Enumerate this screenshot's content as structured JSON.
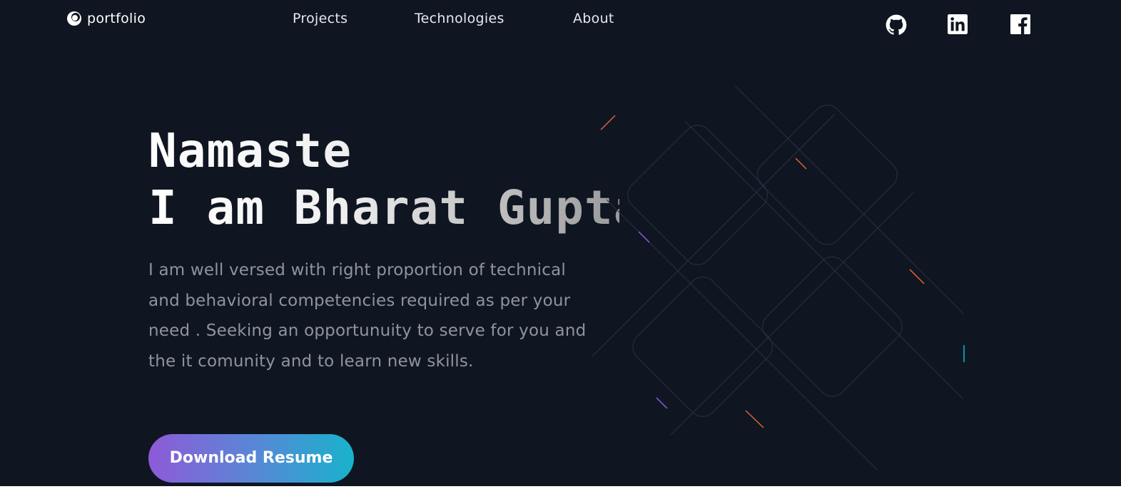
{
  "nav": {
    "logo_text": "portfolio",
    "links": [
      {
        "label": "Projects"
      },
      {
        "label": "Technologies"
      },
      {
        "label": "About"
      }
    ],
    "social_icons": [
      "github-icon",
      "linkedin-icon",
      "facebook-icon"
    ]
  },
  "hero": {
    "title_line1": "Namaste",
    "title_line2": "I am Bharat Gupta",
    "description": "I am well versed with right proportion of technical and behavioral competencies required as per your need . Seeking an opportunuity to serve for you and the it comunity and to learn new skills.",
    "button_label": "Download Resume"
  },
  "colors": {
    "background": "#0f1622",
    "button_gradient_start": "#8e5ad8",
    "button_gradient_end": "#18b2cc",
    "accent_orange": "#e2623a",
    "accent_purple": "#8a5ce0",
    "accent_cyan": "#19b3cc"
  }
}
